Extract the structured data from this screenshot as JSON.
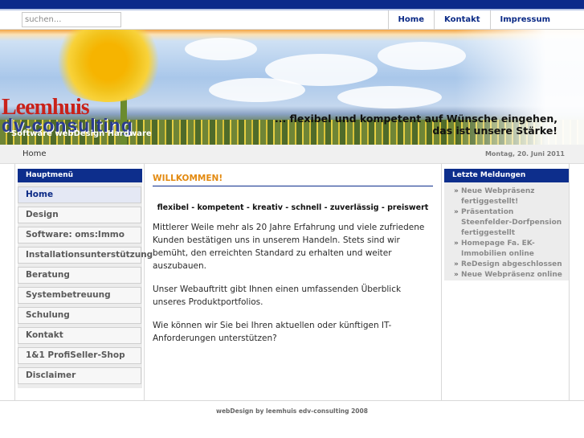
{
  "toolbar": {
    "search_placeholder": "suchen...",
    "nav": [
      "Home",
      "Kontakt",
      "Impressum"
    ]
  },
  "header": {
    "logo_line1": "Leemhuis",
    "logo_line2": "dv-consulting",
    "logo_sub": "Software webDesign Hardware",
    "slogan_line1": "... flexibel und kompetent auf Wünsche eingehen,",
    "slogan_line2": "das ist unsere Stärke!"
  },
  "crumb": {
    "current": "Home",
    "date": "Montag, 20. Juni 2011"
  },
  "menu": {
    "title": "Hauptmenü",
    "items": [
      "Home",
      "Design",
      "Software: oms:Immo",
      "Installationsunterstützung",
      "Beratung",
      "Systembetreuung",
      "Schulung",
      "Kontakt",
      "1&1 ProfiSeller-Shop",
      "Disclaimer"
    ]
  },
  "main": {
    "title": "WILLKOMMEN!",
    "tagline": "flexibel - kompetent - kreativ - schnell - zuverlässig - preiswert",
    "paragraphs": [
      "Mittlerer Weile mehr als 20 Jahre Erfahrung und viele zufriedene Kunden bestätigen uns in unserem Handeln. Stets sind wir bemüht, den erreichten Standard zu erhalten und weiter auszubauen.",
      "Unser Webauftritt gibt Ihnen einen umfassenden Überblick unseres Produktportfolios.",
      "Wie können wir Sie bei Ihren aktuellen oder künftigen IT-Anforderungen unterstützen?"
    ]
  },
  "news": {
    "title": "Letzte Meldungen",
    "items": [
      "Neue Webpräsenz fertiggestellt!",
      "Präsentation Steenfelder-Dorfpension fertiggestellt",
      "Homepage Fa. EK-Immobilien online",
      "ReDesign abgeschlossen",
      "Neue Webpräsenz online"
    ]
  },
  "footer": {
    "text": "webDesign by leemhuis edv-consulting 2008"
  }
}
